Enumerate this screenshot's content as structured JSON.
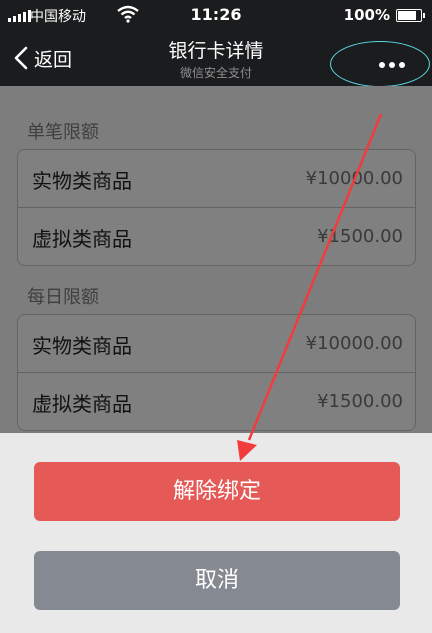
{
  "status_bar": {
    "carrier": "中国移动",
    "time": "11:26",
    "battery": "100%",
    "icons": [
      "signal-icon",
      "wifi-icon",
      "battery-icon"
    ]
  },
  "nav": {
    "back_label": "返回",
    "title": "银行卡详情",
    "subtitle": "微信安全支付",
    "more_icon": "more-dots-icon"
  },
  "sections": [
    {
      "title": "单笔限额",
      "rows": [
        {
          "name": "实物类商品",
          "amount": "¥10000.00"
        },
        {
          "name": "虚拟类商品",
          "amount": "¥1500.00"
        }
      ]
    },
    {
      "title": "每日限额",
      "rows": [
        {
          "name": "实物类商品",
          "amount": "¥10000.00"
        },
        {
          "name": "虚拟类商品",
          "amount": "¥1500.00"
        }
      ]
    }
  ],
  "sheet": {
    "unbind_label": "解除绑定",
    "cancel_label": "取消"
  },
  "colors": {
    "danger": "#e55a57",
    "cancel": "#858992",
    "highlight_ring": "#5ad8e6",
    "annotation_arrow": "#f23b3b"
  }
}
